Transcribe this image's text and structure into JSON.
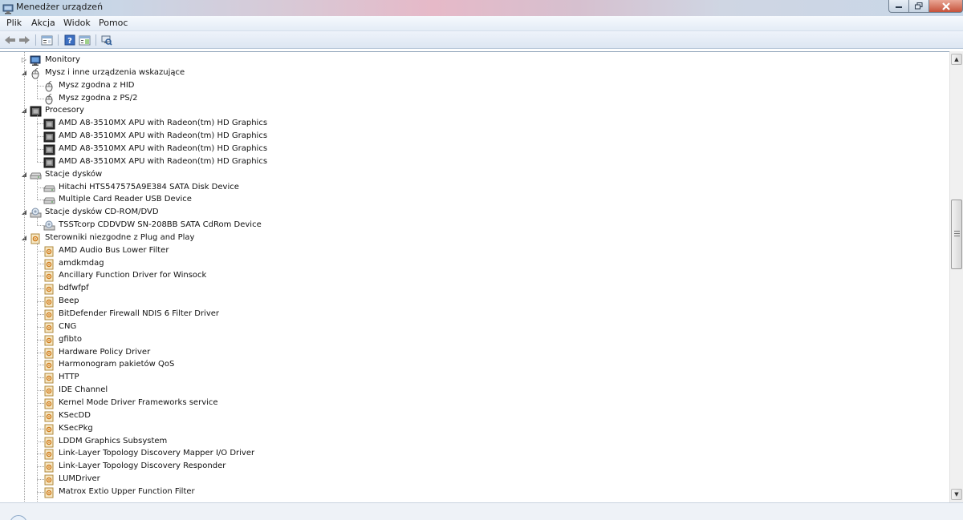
{
  "window": {
    "title": "Menedżer urządzeń",
    "icon": "device-manager-icon"
  },
  "menu": [
    "Plik",
    "Akcja",
    "Widok",
    "Pomoc"
  ],
  "toolbar": [
    "back-icon",
    "forward-icon",
    "properties-icon",
    "help-icon",
    "show-hide-icon",
    "scan-hardware-icon"
  ],
  "tree": [
    {
      "label": "Monitory",
      "level": 0,
      "state": "collapsed",
      "icon": "monitor-icon"
    },
    {
      "label": "Mysz i inne urządzenia wskazujące",
      "level": 0,
      "state": "expanded",
      "icon": "mouse-icon"
    },
    {
      "label": "Mysz zgodna z HID",
      "level": 1,
      "icon": "mouse-icon"
    },
    {
      "label": "Mysz zgodna z PS/2",
      "level": 1,
      "icon": "mouse-icon"
    },
    {
      "label": "Procesory",
      "level": 0,
      "state": "expanded",
      "icon": "processor-icon"
    },
    {
      "label": "AMD A8-3510MX APU with Radeon(tm) HD Graphics",
      "level": 1,
      "icon": "processor-icon"
    },
    {
      "label": "AMD A8-3510MX APU with Radeon(tm) HD Graphics",
      "level": 1,
      "icon": "processor-icon"
    },
    {
      "label": "AMD A8-3510MX APU with Radeon(tm) HD Graphics",
      "level": 1,
      "icon": "processor-icon"
    },
    {
      "label": "AMD A8-3510MX APU with Radeon(tm) HD Graphics",
      "level": 1,
      "icon": "processor-icon"
    },
    {
      "label": "Stacje dysków",
      "level": 0,
      "state": "expanded",
      "icon": "disk-drive-icon"
    },
    {
      "label": "Hitachi HTS547575A9E384 SATA Disk Device",
      "level": 1,
      "icon": "disk-drive-icon"
    },
    {
      "label": "Multiple Card  Reader USB Device",
      "level": 1,
      "icon": "disk-drive-icon"
    },
    {
      "label": "Stacje dysków CD-ROM/DVD",
      "level": 0,
      "state": "expanded",
      "icon": "cdrom-icon"
    },
    {
      "label": "TSSTcorp CDDVDW SN-208BB SATA CdRom Device",
      "level": 1,
      "icon": "cdrom-icon"
    },
    {
      "label": "Sterowniki niezgodne z Plug and Play",
      "level": 0,
      "state": "expanded",
      "icon": "driver-icon"
    },
    {
      "label": "AMD Audio Bus Lower Filter",
      "level": 1,
      "icon": "driver-icon"
    },
    {
      "label": "amdkmdag",
      "level": 1,
      "icon": "driver-icon"
    },
    {
      "label": "Ancillary Function Driver for Winsock",
      "level": 1,
      "icon": "driver-icon"
    },
    {
      "label": "bdfwfpf",
      "level": 1,
      "icon": "driver-icon"
    },
    {
      "label": "Beep",
      "level": 1,
      "icon": "driver-icon"
    },
    {
      "label": "BitDefender Firewall NDIS 6 Filter Driver",
      "level": 1,
      "icon": "driver-icon"
    },
    {
      "label": "CNG",
      "level": 1,
      "icon": "driver-icon"
    },
    {
      "label": "gfibto",
      "level": 1,
      "icon": "driver-icon"
    },
    {
      "label": "Hardware Policy Driver",
      "level": 1,
      "icon": "driver-icon"
    },
    {
      "label": "Harmonogram pakietów QoS",
      "level": 1,
      "icon": "driver-icon"
    },
    {
      "label": "HTTP",
      "level": 1,
      "icon": "driver-icon"
    },
    {
      "label": "IDE Channel",
      "level": 1,
      "icon": "driver-icon"
    },
    {
      "label": "Kernel Mode Driver Frameworks service",
      "level": 1,
      "icon": "driver-icon"
    },
    {
      "label": "KSecDD",
      "level": 1,
      "icon": "driver-icon"
    },
    {
      "label": "KSecPkg",
      "level": 1,
      "icon": "driver-icon"
    },
    {
      "label": "LDDM Graphics Subsystem",
      "level": 1,
      "icon": "driver-icon"
    },
    {
      "label": "Link-Layer Topology Discovery Mapper I/O Driver",
      "level": 1,
      "icon": "driver-icon"
    },
    {
      "label": "Link-Layer Topology Discovery Responder",
      "level": 1,
      "icon": "driver-icon"
    },
    {
      "label": "LUMDriver",
      "level": 1,
      "icon": "driver-icon"
    },
    {
      "label": "Matrox Extio Upper Function Filter",
      "level": 1,
      "icon": "driver-icon"
    }
  ]
}
